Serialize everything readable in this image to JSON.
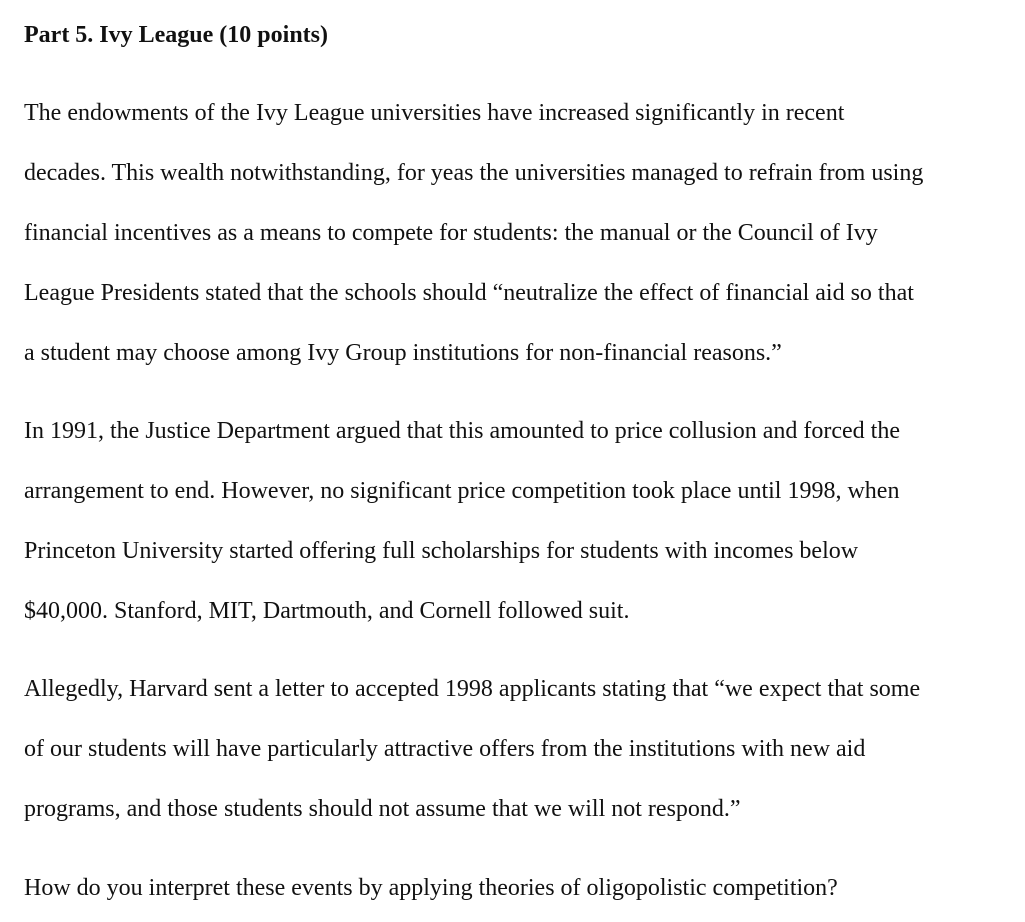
{
  "document": {
    "title": "Part 5. Ivy League (10 points)",
    "paragraphs": [
      {
        "lines": [
          "The endowments of the Ivy League universities have increased significantly in recent",
          "decades. This wealth notwithstanding, for yeas the universities managed to refrain from using",
          "financial incentives as a means to compete for students: the manual or the Council of Ivy",
          "League Presidents stated that the schools should “neutralize the effect of financial aid so that",
          "a student may choose among Ivy Group institutions for non-financial reasons.”"
        ]
      },
      {
        "lines": [
          "In 1991, the Justice Department argued that this amounted to price collusion and forced the",
          "arrangement to end. However, no significant price competition took place until 1998, when",
          "Princeton University started offering full scholarships for students with incomes below",
          "$40,000. Stanford, MIT, Dartmouth, and Cornell followed suit."
        ]
      },
      {
        "lines": [
          "Allegedly, Harvard sent a letter to accepted 1998 applicants stating that “we expect that some",
          "of our students will have particularly attractive offers from the institutions with new aid",
          "programs, and those students should not assume that we will not respond.”"
        ]
      },
      {
        "lines": [
          "How do you interpret these events by applying theories of oligopolistic competition?"
        ]
      }
    ]
  }
}
